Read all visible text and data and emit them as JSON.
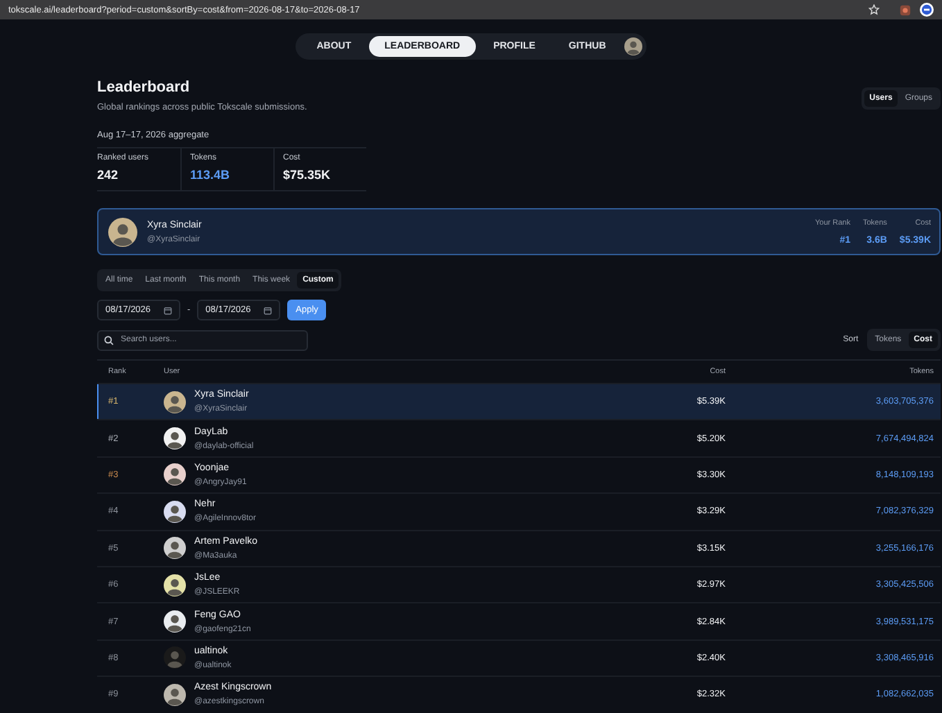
{
  "browser": {
    "url": "tokscale.ai/leaderboard?period=custom&sortBy=cost&from=2026-08-17&to=2026-08-17"
  },
  "nav": [
    {
      "label": "ABOUT",
      "selected": false
    },
    {
      "label": "LEADERBOARD",
      "selected": true
    },
    {
      "label": "PROFILE",
      "selected": false
    },
    {
      "label": "GITHUB",
      "selected": false
    }
  ],
  "header": {
    "title": "Leaderboard",
    "subtitle": "Global rankings across public Tokscale submissions.",
    "aggregate": "Aug 17–17, 2026 aggregate"
  },
  "scope_toggle": [
    {
      "label": "Users",
      "selected": true
    },
    {
      "label": "Groups",
      "selected": false
    }
  ],
  "stats": [
    {
      "label": "Ranked users",
      "value": "242",
      "kind": "plain"
    },
    {
      "label": "Tokens",
      "value": "113.4B",
      "kind": "accent"
    },
    {
      "label": "Cost",
      "value": "$75.35K",
      "kind": "plain"
    }
  ],
  "my_card": {
    "name": "Xyra Sinclair",
    "handle": "@XyraSinclair",
    "stats": [
      {
        "label": "Your Rank",
        "value": "#1"
      },
      {
        "label": "Tokens",
        "value": "3.6B"
      },
      {
        "label": "Cost",
        "value": "$5.39K"
      }
    ]
  },
  "periods": [
    {
      "label": "All time",
      "selected": false
    },
    {
      "label": "Last month",
      "selected": false
    },
    {
      "label": "This month",
      "selected": false
    },
    {
      "label": "This week",
      "selected": false
    },
    {
      "label": "Custom",
      "selected": true
    }
  ],
  "date_range": {
    "from": "08/17/2026",
    "separator": "-",
    "to": "08/17/2026",
    "apply": "Apply"
  },
  "search": {
    "placeholder": "Search users..."
  },
  "sort": {
    "label": "Sort",
    "options": [
      {
        "label": "Tokens",
        "selected": false
      },
      {
        "label": "Cost",
        "selected": true
      }
    ]
  },
  "table": {
    "columns": [
      "Rank",
      "User",
      "Cost",
      "Tokens"
    ],
    "rows": [
      {
        "rank": "#1",
        "color": "#d4b26a",
        "name": "Xyra Sinclair",
        "handle": "@XyraSinclair",
        "cost": "$5.39K",
        "tokens": "3,603,705,376",
        "selected": true
      },
      {
        "rank": "#2",
        "color": "#a9adb5",
        "name": "DayLab",
        "handle": "@daylab-official",
        "cost": "$5.20K",
        "tokens": "7,674,494,824",
        "selected": false
      },
      {
        "rank": "#3",
        "color": "#c98a4e",
        "name": "Yoonjae",
        "handle": "@AngryJay91",
        "cost": "$3.30K",
        "tokens": "8,148,109,193",
        "selected": false
      },
      {
        "rank": "#4",
        "color": "#8b9099",
        "name": "Nehr",
        "handle": "@AgileInnov8tor",
        "cost": "$3.29K",
        "tokens": "7,082,376,329",
        "selected": false
      },
      {
        "rank": "#5",
        "color": "#8b9099",
        "name": "Artem Pavelko",
        "handle": "@Ma3auka",
        "cost": "$3.15K",
        "tokens": "3,255,166,176",
        "selected": false
      },
      {
        "rank": "#6",
        "color": "#8b9099",
        "name": "JsLee",
        "handle": "@JSLEEKR",
        "cost": "$2.97K",
        "tokens": "3,305,425,506",
        "selected": false
      },
      {
        "rank": "#7",
        "color": "#8b9099",
        "name": "Feng GAO",
        "handle": "@gaofeng21cn",
        "cost": "$2.84K",
        "tokens": "3,989,531,175",
        "selected": false
      },
      {
        "rank": "#8",
        "color": "#8b9099",
        "name": "ualtinok",
        "handle": "@ualtinok",
        "cost": "$2.40K",
        "tokens": "3,308,465,916",
        "selected": false
      },
      {
        "rank": "#9",
        "color": "#8b9099",
        "name": "Azest Kingscrown",
        "handle": "@azestkingscrown",
        "cost": "$2.32K",
        "tokens": "1,082,662,035",
        "selected": false
      }
    ]
  }
}
